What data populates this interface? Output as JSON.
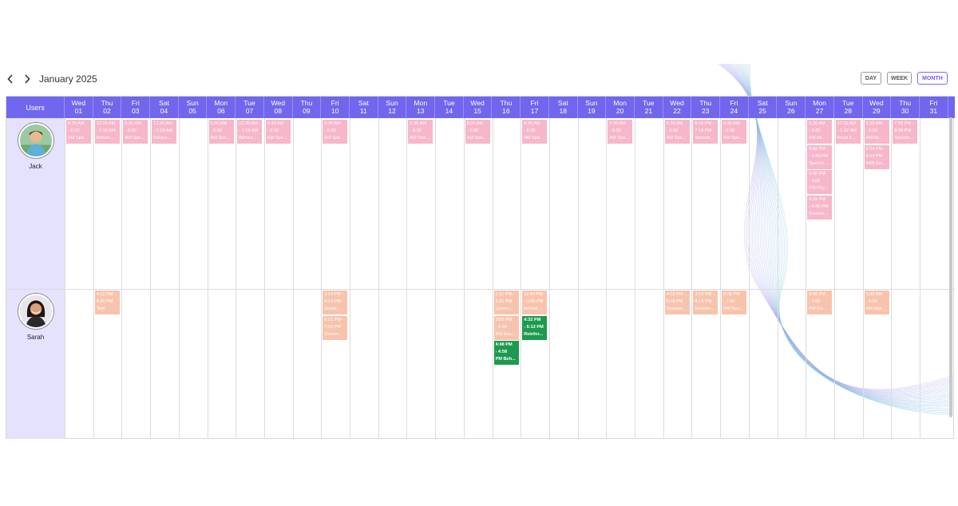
{
  "header": {
    "month_title": "January 2025",
    "prev_icon": "chevron-left-icon",
    "next_icon": "chevron-right-icon",
    "views": [
      {
        "label": "DAY",
        "active": false
      },
      {
        "label": "WEEK",
        "active": false
      },
      {
        "label": "MONTH",
        "active": true
      }
    ]
  },
  "grid": {
    "users_label": "Users",
    "days": [
      {
        "dow": "Wed",
        "d": "01"
      },
      {
        "dow": "Thu",
        "d": "02"
      },
      {
        "dow": "Fri",
        "d": "03"
      },
      {
        "dow": "Sat",
        "d": "04"
      },
      {
        "dow": "Sun",
        "d": "05"
      },
      {
        "dow": "Mon",
        "d": "06"
      },
      {
        "dow": "Tue",
        "d": "07"
      },
      {
        "dow": "Wed",
        "d": "08"
      },
      {
        "dow": "Thu",
        "d": "09"
      },
      {
        "dow": "Fri",
        "d": "10"
      },
      {
        "dow": "Sat",
        "d": "11"
      },
      {
        "dow": "Sun",
        "d": "12"
      },
      {
        "dow": "Mon",
        "d": "13"
      },
      {
        "dow": "Tue",
        "d": "14"
      },
      {
        "dow": "Wed",
        "d": "15"
      },
      {
        "dow": "Thu",
        "d": "16"
      },
      {
        "dow": "Fri",
        "d": "17"
      },
      {
        "dow": "Sat",
        "d": "18"
      },
      {
        "dow": "Sun",
        "d": "19"
      },
      {
        "dow": "Mon",
        "d": "20"
      },
      {
        "dow": "Tue",
        "d": "21"
      },
      {
        "dow": "Wed",
        "d": "22"
      },
      {
        "dow": "Thu",
        "d": "23"
      },
      {
        "dow": "Fri",
        "d": "24"
      },
      {
        "dow": "Sat",
        "d": "25"
      },
      {
        "dow": "Sun",
        "d": "26"
      },
      {
        "dow": "Mon",
        "d": "27"
      },
      {
        "dow": "Tue",
        "d": "28"
      },
      {
        "dow": "Wed",
        "d": "29"
      },
      {
        "dow": "Thu",
        "d": "30"
      },
      {
        "dow": "Fri",
        "d": "31"
      }
    ],
    "users": [
      {
        "name": "Jack",
        "avatar_icon": "boy-avatar"
      },
      {
        "name": "Sarah",
        "avatar_icon": "woman-avatar"
      }
    ]
  },
  "colors": {
    "header_bg": "#7166ee",
    "users_bg": "#e4e2fd",
    "pink": "#f7b6c9",
    "peach": "#f8c3ad",
    "green": "#1d9a4f"
  },
  "events": [
    {
      "user": 0,
      "day": 0,
      "slot": 0,
      "color": "pink",
      "lines": [
        "5:30 AM",
        "- 6:30",
        "AM Spe..."
      ]
    },
    {
      "user": 0,
      "day": 1,
      "slot": 0,
      "color": "pink",
      "lines": [
        "12:20 AM",
        "- 1:18 AM",
        "Behavi..."
      ]
    },
    {
      "user": 0,
      "day": 2,
      "slot": 0,
      "color": "pink",
      "lines": [
        "5:30 AM",
        "- 6:30",
        "AM Spe..."
      ]
    },
    {
      "user": 0,
      "day": 3,
      "slot": 0,
      "color": "pink",
      "lines": [
        "12:20 AM",
        "- 1:18 AM",
        "Behavi..."
      ]
    },
    {
      "user": 0,
      "day": 5,
      "slot": 0,
      "color": "pink",
      "lines": [
        "5:30 AM",
        "- 6:30",
        "AM Spe..."
      ]
    },
    {
      "user": 0,
      "day": 6,
      "slot": 0,
      "color": "pink",
      "lines": [
        "12:20 AM",
        "- 1:18 AM",
        "Behavi..."
      ]
    },
    {
      "user": 0,
      "day": 7,
      "slot": 0,
      "color": "pink",
      "lines": [
        "5:30 AM",
        "- 6:30",
        "AM Spe..."
      ]
    },
    {
      "user": 0,
      "day": 9,
      "slot": 0,
      "color": "pink",
      "lines": [
        "5:30 AM",
        "- 6:30",
        "AM Spe..."
      ]
    },
    {
      "user": 0,
      "day": 12,
      "slot": 0,
      "color": "pink",
      "lines": [
        "5:30 AM",
        "- 6:30",
        "AM Spe..."
      ]
    },
    {
      "user": 0,
      "day": 14,
      "slot": 0,
      "color": "pink",
      "lines": [
        "5:30 AM",
        "- 6:30",
        "AM Spe..."
      ]
    },
    {
      "user": 0,
      "day": 16,
      "slot": 0,
      "color": "pink",
      "lines": [
        "5:30 AM",
        "- 6:30",
        "AM Spe..."
      ]
    },
    {
      "user": 0,
      "day": 19,
      "slot": 0,
      "color": "pink",
      "lines": [
        "5:30 AM",
        "- 6:30",
        "AM Spe..."
      ]
    },
    {
      "user": 0,
      "day": 21,
      "slot": 0,
      "color": "pink",
      "lines": [
        "5:30 AM",
        "- 6:30",
        "AM Spe..."
      ]
    },
    {
      "user": 0,
      "day": 22,
      "slot": 0,
      "color": "pink",
      "lines": [
        "6:18 PM -",
        "7:18 PM",
        "Speech ..."
      ]
    },
    {
      "user": 0,
      "day": 23,
      "slot": 0,
      "color": "pink",
      "lines": [
        "5:30 AM",
        "- 6:30",
        "AM Spe..."
      ]
    },
    {
      "user": 0,
      "day": 26,
      "slot": 0,
      "color": "pink",
      "lines": [
        "5:30 AM",
        "- 6:30",
        "AM All..."
      ]
    },
    {
      "user": 0,
      "day": 26,
      "slot": 1,
      "color": "pink",
      "lines": [
        "5:58 PM",
        "- 6:40 PM",
        "Speech ..."
      ]
    },
    {
      "user": 0,
      "day": 26,
      "slot": 2,
      "color": "pink",
      "lines": [
        "6:00 PM",
        "- 6:05",
        "PM Phy..."
      ]
    },
    {
      "user": 0,
      "day": 26,
      "slot": 3,
      "color": "pink",
      "lines": [
        "6:29 PM",
        "- 6:45 PM",
        "Counse..."
      ]
    },
    {
      "user": 0,
      "day": 27,
      "slot": 0,
      "color": "pink",
      "lines": [
        "12:32 AM",
        "- 1:32 AM",
        "Read E..."
      ]
    },
    {
      "user": 0,
      "day": 28,
      "slot": 0,
      "color": "pink",
      "lines": [
        "5:30 AM",
        "- 6:30",
        "AM All..."
      ]
    },
    {
      "user": 0,
      "day": 28,
      "slot": 1,
      "color": "pink",
      "lines": [
        "8:24 PM -",
        "9:24 PM",
        "ABA Se..."
      ]
    },
    {
      "user": 0,
      "day": 29,
      "slot": 0,
      "color": "pink",
      "lines": [
        "7:58 PM -",
        "8:58 PM",
        "Speech ..."
      ]
    },
    {
      "user": 1,
      "day": 1,
      "slot": 0,
      "color": "peach",
      "lines": [
        "4:12 PM -",
        "4:20 PM",
        "Test"
      ]
    },
    {
      "user": 1,
      "day": 9,
      "slot": 0,
      "color": "peach",
      "lines": [
        "3:14 PM -",
        "4:14 PM",
        "Social ..."
      ]
    },
    {
      "user": 1,
      "day": 9,
      "slot": 1,
      "color": "peach",
      "lines": [
        "6:51 PM -",
        "7:51 PM",
        "Comm..."
      ]
    },
    {
      "user": 1,
      "day": 15,
      "slot": 0,
      "color": "peach",
      "lines": [
        "1:21 PM -",
        "2:21 PM",
        "Comm..."
      ]
    },
    {
      "user": 1,
      "day": 15,
      "slot": 1,
      "color": "peach",
      "lines": [
        "3:55 PM",
        "- 4:06",
        "PM Ses..."
      ]
    },
    {
      "user": 1,
      "day": 15,
      "slot": 2,
      "color": "green",
      "lines": [
        "4:48 PM",
        "- 4:58",
        "PM Beh..."
      ]
    },
    {
      "user": 1,
      "day": 16,
      "slot": 0,
      "color": "peach",
      "lines": [
        "12:04 PM",
        "- 1:00 PM",
        "Behavi..."
      ]
    },
    {
      "user": 1,
      "day": 16,
      "slot": 1,
      "color": "green",
      "lines": [
        "4:32 PM",
        "- 5:12 PM",
        "Reinfor..."
      ]
    },
    {
      "user": 1,
      "day": 21,
      "slot": 0,
      "color": "peach",
      "lines": [
        "4:18 PM -",
        "5:18 PM",
        "Session..."
      ]
    },
    {
      "user": 1,
      "day": 22,
      "slot": 0,
      "color": "peach",
      "lines": [
        "3:19 PM -",
        "4:19 PM",
        "Session..."
      ]
    },
    {
      "user": 1,
      "day": 23,
      "slot": 0,
      "color": "peach",
      "lines": [
        "6:00 PM",
        "- 7:00",
        "PM Ses..."
      ]
    },
    {
      "user": 1,
      "day": 26,
      "slot": 0,
      "color": "peach",
      "lines": [
        "5:55 PM",
        "- 6:52",
        "PM Ge..."
      ]
    },
    {
      "user": 1,
      "day": 28,
      "slot": 0,
      "color": "peach",
      "lines": [
        "5:30 AM",
        "- 6:30",
        "AM Spe..."
      ]
    }
  ]
}
